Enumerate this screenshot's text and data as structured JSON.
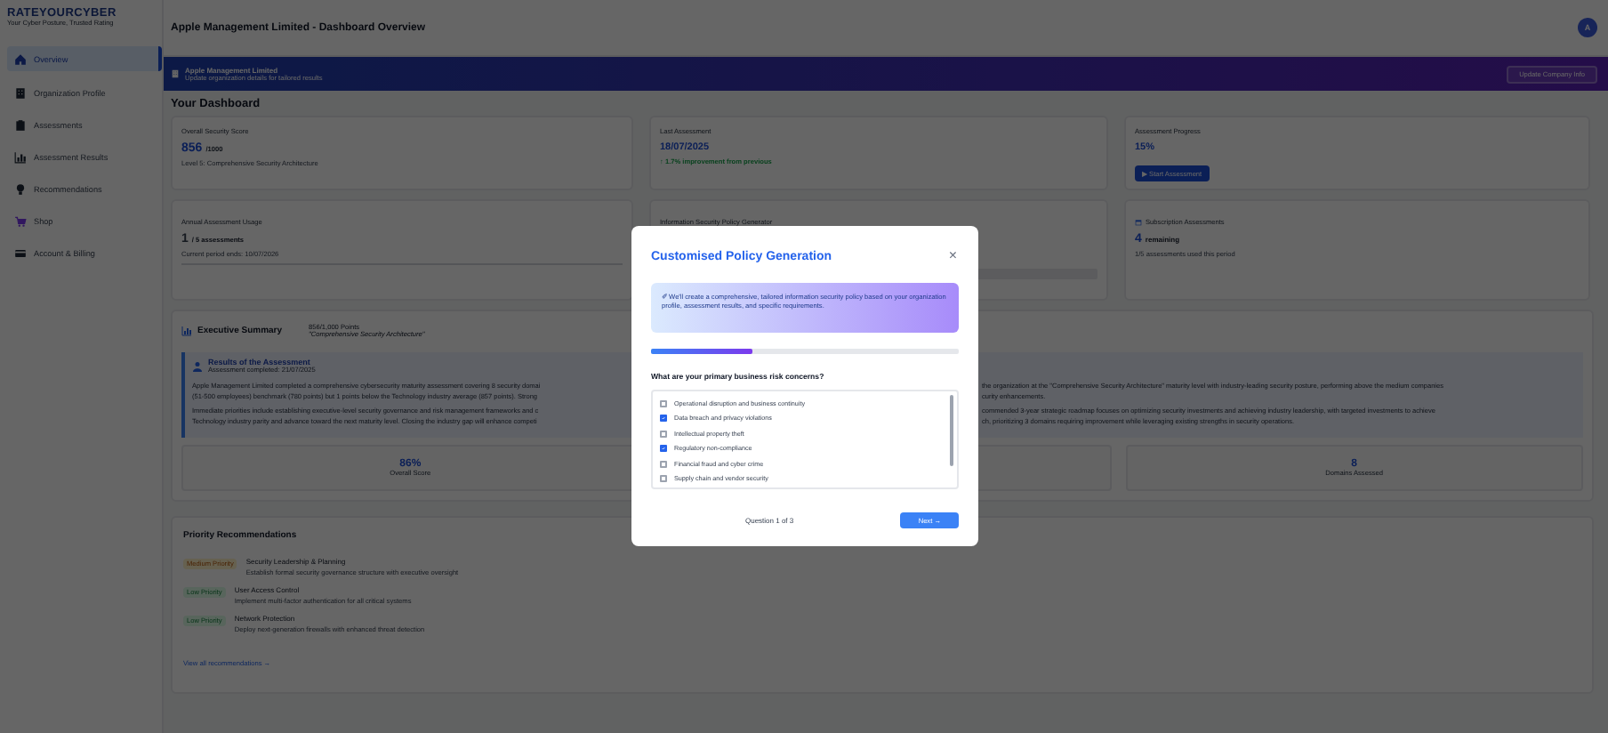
{
  "sidebar": {
    "logo": "RATEYOURCYBER",
    "tagline": "Your Cyber Posture, Trusted Rating",
    "items": [
      {
        "label": "Overview",
        "selected": true
      },
      {
        "label": "Organization Profile",
        "selected": false
      },
      {
        "label": "Assessments",
        "selected": false
      },
      {
        "label": "Assessment Results",
        "selected": false
      },
      {
        "label": "Recommendations",
        "selected": false
      },
      {
        "label": "Shop",
        "selected": false
      },
      {
        "label": "Account & Billing",
        "selected": false
      }
    ]
  },
  "header": {
    "title": "Apple Management Limited - Dashboard Overview",
    "avatar": "A"
  },
  "banner": {
    "title": "Apple Management Limited",
    "subtitle": "Update organization details for tailored results",
    "button": "Update Company Info"
  },
  "dashboard_title": "Your Dashboard",
  "cards": [
    {
      "kind": "score",
      "label": "Overall Security Score",
      "value": "856",
      "unit": "/1000",
      "note": "Level 5: Comprehensive Security Architecture"
    },
    {
      "kind": "date",
      "label": "Last Assessment",
      "value": "18/07/2025",
      "note": "↑ 1.7% improvement from previous"
    },
    {
      "kind": "progress",
      "label": "Assessment Progress",
      "value": "15%",
      "button": "▶ Start Assessment"
    },
    {
      "kind": "usage",
      "label": "Annual Assessment Usage",
      "value": "1",
      "unit": "/ 5 assessments",
      "note": "Current period ends: 10/07/2026"
    },
    {
      "kind": "policy",
      "label": "Information Security Policy Generator"
    },
    {
      "kind": "subscription",
      "label": "Subscription Assessments",
      "value": "4",
      "unit": "remaining",
      "note": "1/5 assessments used this period"
    }
  ],
  "executive_summary": {
    "title": "Executive Summary",
    "score": "856/1,000 Points",
    "level": "\"Comprehensive Security Architecture\"",
    "results_title": "Results of the Assessment",
    "results_subtitle": "Assessment completed: 21/07/2025",
    "paragraphs": [
      [
        {
          "left": "Apple Management Limited completed a comprehensive cybersecurity maturity assessment covering 8 security domai",
          "right": "the organization at the \"Comprehensive Security Architecture\" maturity level with industry-leading security posture, performing above the medium companies"
        },
        {
          "left": "(51-500 employees) benchmark (780 points) but 1 points below the Technology industry average (857 points). Strong",
          "right": "curity enhancements."
        }
      ],
      [
        {
          "left": "Immediate priorities include establishing executive-level security governance and risk management frameworks and c",
          "right": "commended 3-year strategic roadmap focuses on optimizing security investments and achieving industry leadership, with targeted investments to achieve"
        },
        {
          "left": "Technology industry parity and advance toward the next maturity level. Closing the industry gap will enhance competi",
          "right": "ch, prioritizing 3 domains requiring improvement while leveraging existing strengths in security operations."
        }
      ]
    ],
    "stats": [
      {
        "value": "86%",
        "label": "Overall Score"
      },
      {
        "value": "8",
        "label": "Domains Assessed"
      }
    ]
  },
  "priority": {
    "title": "Priority Recommendations",
    "items": [
      {
        "kind": "medium",
        "priority": "Medium Priority",
        "title": "Security Leadership & Planning",
        "description": "Establish formal security governance structure with executive oversight"
      },
      {
        "kind": "low",
        "priority": "Low Priority",
        "title": "User Access Control",
        "description": "Implement multi-factor authentication for all critical systems"
      },
      {
        "kind": "low",
        "priority": "Low Priority",
        "title": "Network Protection",
        "description": "Deploy next-generation firewalls with enhanced threat detection"
      }
    ],
    "link": "View all recommendations →"
  },
  "modal": {
    "title": "Customised Policy Generation",
    "close": "×",
    "info": "✐ We'll create a comprehensive, tailored information security policy based on your organization profile, assessment results, and specific requirements.",
    "progress": {
      "level": 0.33
    },
    "question": "What are your primary business risk concerns?",
    "options": [
      {
        "label": "Operational disruption and business continuity",
        "checked": false
      },
      {
        "label": "Data breach and privacy violations",
        "checked": true
      },
      {
        "label": "Intellectual property theft",
        "checked": false
      },
      {
        "label": "Regulatory non-compliance",
        "checked": true
      },
      {
        "label": "Financial fraud and cyber crime",
        "checked": false
      },
      {
        "label": "Supply chain and vendor security",
        "checked": false
      }
    ],
    "footer": "Question 1 of 3",
    "next": "Next →"
  }
}
